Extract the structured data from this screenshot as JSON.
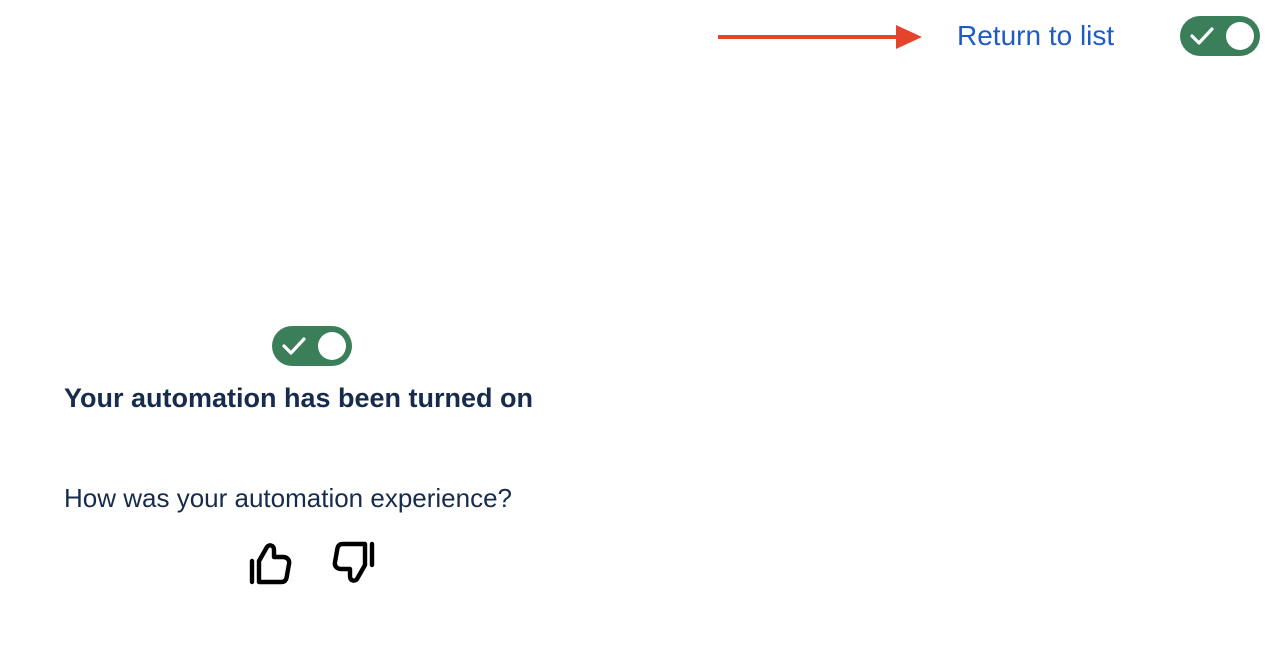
{
  "header": {
    "return_label": "Return to list",
    "toggle_state": "on"
  },
  "main": {
    "toggle_state": "on",
    "headline": "Your automation has been turned on",
    "question": "How was your automation experience?",
    "feedback": {
      "thumbs_up_icon": "thumbs-up-icon",
      "thumbs_down_icon": "thumbs-down-icon"
    }
  },
  "colors": {
    "toggle_on": "#3b7f5a",
    "link": "#1f5bc4",
    "text": "#172b4d",
    "annotation_arrow": "#e5432c"
  }
}
